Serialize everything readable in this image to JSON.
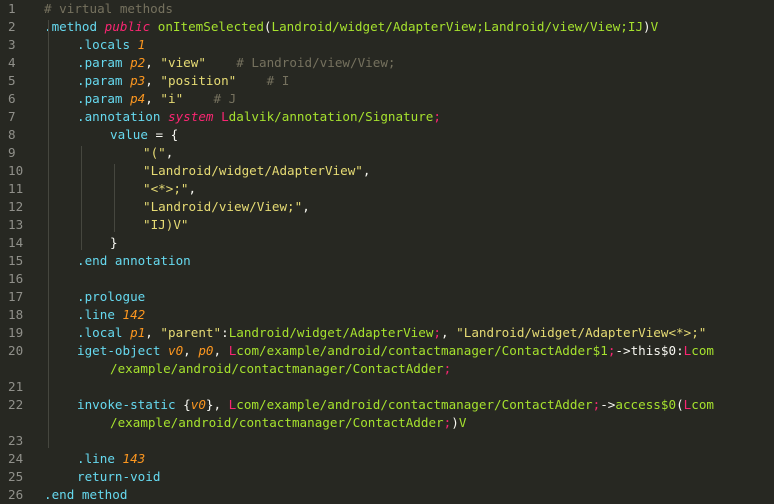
{
  "editor": {
    "theme": "monokai",
    "colors": {
      "background": "#272822",
      "gutter_text": "#90908a",
      "default": "#f8f8f2",
      "directive": "#66d9ef",
      "keyword": "#f92672",
      "function": "#a6e22e",
      "comment": "#75715e",
      "string": "#e6db74",
      "param": "#fd971f"
    },
    "lines": [
      {
        "n": "1",
        "indent": 0,
        "tokens": [
          {
            "t": "c",
            "v": "# virtual methods"
          }
        ]
      },
      {
        "n": "2",
        "indent": 0,
        "tokens": [
          {
            "t": "d",
            "v": ".method "
          },
          {
            "t": "k",
            "v": "public "
          },
          {
            "t": "f",
            "v": "onItemSelected"
          },
          {
            "t": "o",
            "v": "("
          },
          {
            "t": "f",
            "v": "Landroid/widget/AdapterView;Landroid/view/View;IJ"
          },
          {
            "t": "o",
            "v": ")"
          },
          {
            "t": "f",
            "v": "V"
          }
        ]
      },
      {
        "n": "3",
        "indent": 1,
        "tokens": [
          {
            "t": "d",
            "v": ".locals "
          },
          {
            "t": "p",
            "v": "1"
          }
        ]
      },
      {
        "n": "4",
        "indent": 1,
        "tokens": [
          {
            "t": "d",
            "v": ".param "
          },
          {
            "t": "p",
            "v": "p2"
          },
          {
            "t": "o",
            "v": ", "
          },
          {
            "t": "s",
            "v": "\"view\""
          },
          {
            "t": "o",
            "v": "    "
          },
          {
            "t": "c",
            "v": "# Landroid/view/View;"
          }
        ]
      },
      {
        "n": "5",
        "indent": 1,
        "tokens": [
          {
            "t": "d",
            "v": ".param "
          },
          {
            "t": "p",
            "v": "p3"
          },
          {
            "t": "o",
            "v": ", "
          },
          {
            "t": "s",
            "v": "\"position\""
          },
          {
            "t": "o",
            "v": "    "
          },
          {
            "t": "c",
            "v": "# I"
          }
        ]
      },
      {
        "n": "6",
        "indent": 1,
        "tokens": [
          {
            "t": "d",
            "v": ".param "
          },
          {
            "t": "p",
            "v": "p4"
          },
          {
            "t": "o",
            "v": ", "
          },
          {
            "t": "s",
            "v": "\"i\""
          },
          {
            "t": "o",
            "v": "    "
          },
          {
            "t": "c",
            "v": "# J"
          }
        ]
      },
      {
        "n": "7",
        "indent": 1,
        "tokens": [
          {
            "t": "d",
            "v": ".annotation "
          },
          {
            "t": "k",
            "v": "system "
          },
          {
            "t": "r",
            "v": "L"
          },
          {
            "t": "f",
            "v": "dalvik/annotation/Signature"
          },
          {
            "t": "r",
            "v": ";"
          }
        ]
      },
      {
        "n": "8",
        "indent": 2,
        "tokens": [
          {
            "t": "d",
            "v": "value "
          },
          {
            "t": "o",
            "v": "= {"
          }
        ]
      },
      {
        "n": "9",
        "indent": 3,
        "tokens": [
          {
            "t": "s",
            "v": "\"(\""
          },
          {
            "t": "o",
            "v": ","
          }
        ]
      },
      {
        "n": "10",
        "indent": 3,
        "tokens": [
          {
            "t": "s",
            "v": "\"Landroid/widget/AdapterView\""
          },
          {
            "t": "o",
            "v": ","
          }
        ]
      },
      {
        "n": "11",
        "indent": 3,
        "tokens": [
          {
            "t": "s",
            "v": "\"<*>;\""
          },
          {
            "t": "o",
            "v": ","
          }
        ]
      },
      {
        "n": "12",
        "indent": 3,
        "tokens": [
          {
            "t": "s",
            "v": "\"Landroid/view/View;\""
          },
          {
            "t": "o",
            "v": ","
          }
        ]
      },
      {
        "n": "13",
        "indent": 3,
        "tokens": [
          {
            "t": "s",
            "v": "\"IJ)V\""
          }
        ]
      },
      {
        "n": "14",
        "indent": 2,
        "tokens": [
          {
            "t": "o",
            "v": "}"
          }
        ]
      },
      {
        "n": "15",
        "indent": 1,
        "tokens": [
          {
            "t": "d",
            "v": ".end annotation"
          }
        ]
      },
      {
        "n": "16",
        "indent": 0,
        "tokens": []
      },
      {
        "n": "17",
        "indent": 1,
        "tokens": [
          {
            "t": "d",
            "v": ".prologue"
          }
        ]
      },
      {
        "n": "18",
        "indent": 1,
        "tokens": [
          {
            "t": "d",
            "v": ".line "
          },
          {
            "t": "p",
            "v": "142"
          }
        ]
      },
      {
        "n": "19",
        "indent": 1,
        "tokens": [
          {
            "t": "d",
            "v": ".local "
          },
          {
            "t": "p",
            "v": "p1"
          },
          {
            "t": "o",
            "v": ", "
          },
          {
            "t": "s",
            "v": "\"parent\""
          },
          {
            "t": "o",
            "v": ":"
          },
          {
            "t": "f",
            "v": "Landroid/widget/AdapterView"
          },
          {
            "t": "r",
            "v": ";"
          },
          {
            "t": "o",
            "v": ", "
          },
          {
            "t": "s",
            "v": "\"Landroid/widget/AdapterView<*>;\""
          }
        ]
      },
      {
        "n": "20",
        "indent": 1,
        "tokens": [
          {
            "t": "d",
            "v": "iget-object "
          },
          {
            "t": "p",
            "v": "v0"
          },
          {
            "t": "o",
            "v": ", "
          },
          {
            "t": "p",
            "v": "p0"
          },
          {
            "t": "o",
            "v": ", "
          },
          {
            "t": "r",
            "v": "L"
          },
          {
            "t": "f",
            "v": "com/example/android/contactmanager/ContactAdder$1"
          },
          {
            "t": "r",
            "v": ";"
          },
          {
            "t": "o",
            "v": "->this$0:"
          },
          {
            "t": "r",
            "v": "L"
          },
          {
            "t": "f",
            "v": "com"
          }
        ]
      },
      {
        "n": "",
        "indent": 2,
        "tokens": [
          {
            "t": "f",
            "v": "/example/android/contactmanager/ContactAdder"
          },
          {
            "t": "r",
            "v": ";"
          }
        ]
      },
      {
        "n": "21",
        "indent": 0,
        "tokens": []
      },
      {
        "n": "22",
        "indent": 1,
        "tokens": [
          {
            "t": "d",
            "v": "invoke-static "
          },
          {
            "t": "o",
            "v": "{"
          },
          {
            "t": "p",
            "v": "v0"
          },
          {
            "t": "o",
            "v": "}, "
          },
          {
            "t": "r",
            "v": "L"
          },
          {
            "t": "f",
            "v": "com/example/android/contactmanager/ContactAdder"
          },
          {
            "t": "r",
            "v": ";"
          },
          {
            "t": "o",
            "v": "->"
          },
          {
            "t": "f",
            "v": "access$0"
          },
          {
            "t": "o",
            "v": "("
          },
          {
            "t": "r",
            "v": "L"
          },
          {
            "t": "f",
            "v": "com"
          }
        ]
      },
      {
        "n": "",
        "indent": 2,
        "tokens": [
          {
            "t": "f",
            "v": "/example/android/contactmanager/ContactAdder"
          },
          {
            "t": "r",
            "v": ";"
          },
          {
            "t": "o",
            "v": ")"
          },
          {
            "t": "f",
            "v": "V"
          }
        ]
      },
      {
        "n": "23",
        "indent": 0,
        "tokens": []
      },
      {
        "n": "24",
        "indent": 1,
        "tokens": [
          {
            "t": "d",
            "v": ".line "
          },
          {
            "t": "p",
            "v": "143"
          }
        ]
      },
      {
        "n": "25",
        "indent": 1,
        "tokens": [
          {
            "t": "d",
            "v": "return-void"
          }
        ]
      },
      {
        "n": "26",
        "indent": 0,
        "tokens": [
          {
            "t": "d",
            "v": ".end method"
          }
        ]
      }
    ]
  }
}
